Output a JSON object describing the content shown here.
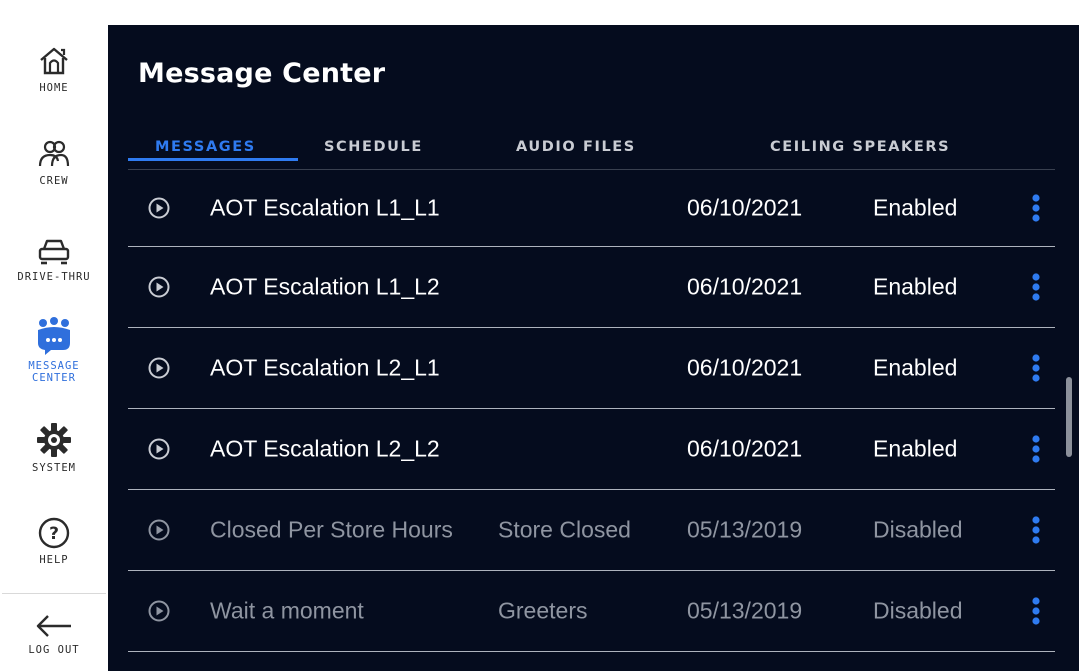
{
  "sidebar": {
    "items": [
      {
        "label": "HOME",
        "icon": "home-icon",
        "active": false
      },
      {
        "label": "CREW",
        "icon": "crew-icon",
        "active": false
      },
      {
        "label": "DRIVE-THRU",
        "icon": "car-icon",
        "active": false
      },
      {
        "label": "MESSAGE\nCENTER",
        "icon": "message-center-icon",
        "active": true
      },
      {
        "label": "SYSTEM",
        "icon": "gear-icon",
        "active": false
      },
      {
        "label": "HELP",
        "icon": "help-icon",
        "active": false
      }
    ],
    "logout": {
      "label": "LOG OUT",
      "icon": "arrow-left-icon"
    }
  },
  "page": {
    "title": "Message Center"
  },
  "tabs": [
    {
      "label": "MESSAGES",
      "active": true
    },
    {
      "label": "SCHEDULE",
      "active": false
    },
    {
      "label": "AUDIO FILES",
      "active": false
    },
    {
      "label": "CEILING SPEAKERS",
      "active": false
    }
  ],
  "messages": [
    {
      "name": "AOT Escalation L1_L1",
      "category": "",
      "date": "06/10/2021",
      "status": "Enabled"
    },
    {
      "name": "AOT Escalation L1_L2",
      "category": "",
      "date": "06/10/2021",
      "status": "Enabled"
    },
    {
      "name": "AOT Escalation L2_L1",
      "category": "",
      "date": "06/10/2021",
      "status": "Enabled"
    },
    {
      "name": "AOT Escalation L2_L2",
      "category": "",
      "date": "06/10/2021",
      "status": "Enabled"
    },
    {
      "name": "Closed Per Store Hours",
      "category": "Store Closed",
      "date": "05/13/2019",
      "status": "Disabled"
    },
    {
      "name": "Wait a moment",
      "category": "Greeters",
      "date": "05/13/2019",
      "status": "Disabled"
    }
  ],
  "colors": {
    "background": "#050c1e",
    "accent": "#2f7bf0",
    "enabled_text": "#ffffff",
    "disabled_text": "#8f95a1",
    "sidebar_icon": "#2b2b2b"
  }
}
